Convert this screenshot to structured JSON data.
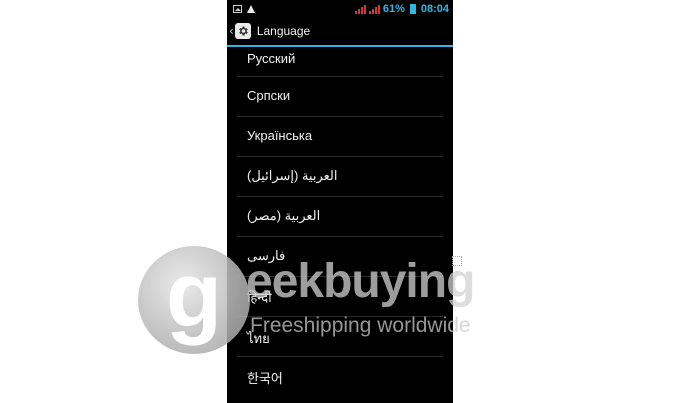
{
  "status_bar": {
    "battery": "61%",
    "time": "08:04",
    "icons": [
      "image-notification-icon",
      "warning-icon",
      "signal-icon",
      "signal-icon",
      "battery-icon"
    ],
    "colors": {
      "accent": "#2fb7e6",
      "signal": "#d23a3a"
    }
  },
  "action_bar": {
    "title": "Language",
    "icons": [
      "back-chevron-icon",
      "gear-icon"
    ]
  },
  "languages": [
    {
      "label": "Русский"
    },
    {
      "label": "Српски"
    },
    {
      "label": "Українська"
    },
    {
      "label": "العربية (إسرائيل)"
    },
    {
      "label": "العربية (مصر)"
    },
    {
      "label": "فارسی"
    },
    {
      "label": "हिन्दी"
    },
    {
      "label": "ไทย"
    },
    {
      "label": "한국어"
    }
  ],
  "watermark": {
    "logo_letter": "g",
    "brand": "eekbuying",
    "tagline": "Freeshipping worldwide"
  }
}
